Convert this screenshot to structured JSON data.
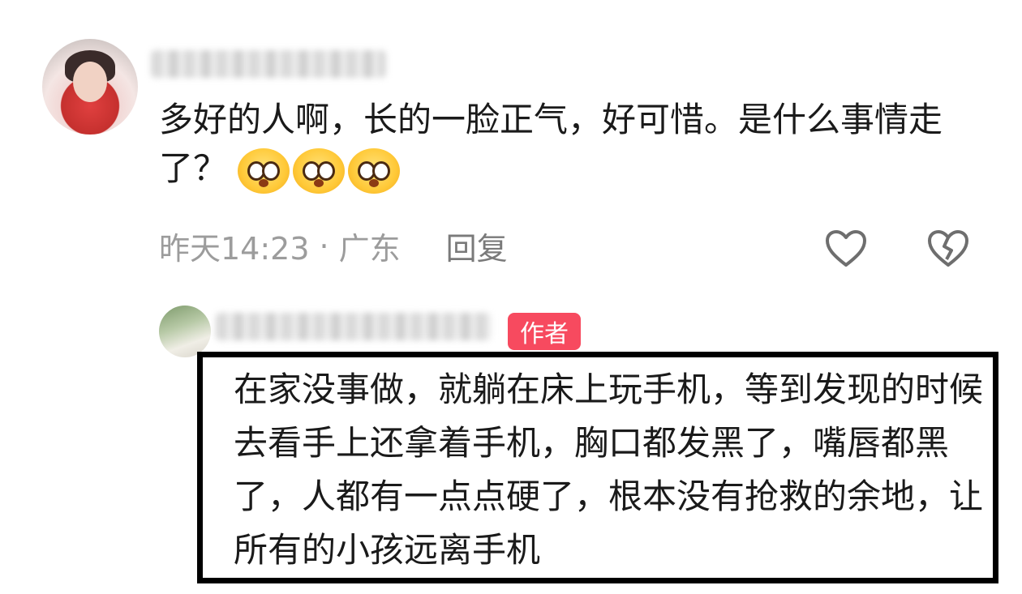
{
  "main_comment": {
    "text": "多好的人啊，长的一脸正气，好可惜。是什么事情走了？",
    "emoji_count": 3,
    "emoji_icon": "pleading-face-icon",
    "time": "昨天14:23",
    "separator": "·",
    "location": "广东",
    "reply_label": "回复"
  },
  "reply": {
    "badge": "作者",
    "text": "在家没事做，就躺在床上玩手机，等到发现的时候去看手上还拿着手机，胸口都发黑了，嘴唇都黑了，人都有一点点硬了，根本没有抢救的余地，让所有的小孩远离手机"
  },
  "icons": {
    "like": "heart-outline-icon",
    "dislike": "broken-heart-icon"
  },
  "colors": {
    "badge_bg": "#f74a5f",
    "meta_text": "#9c9c9c",
    "highlight_border": "#000000"
  }
}
